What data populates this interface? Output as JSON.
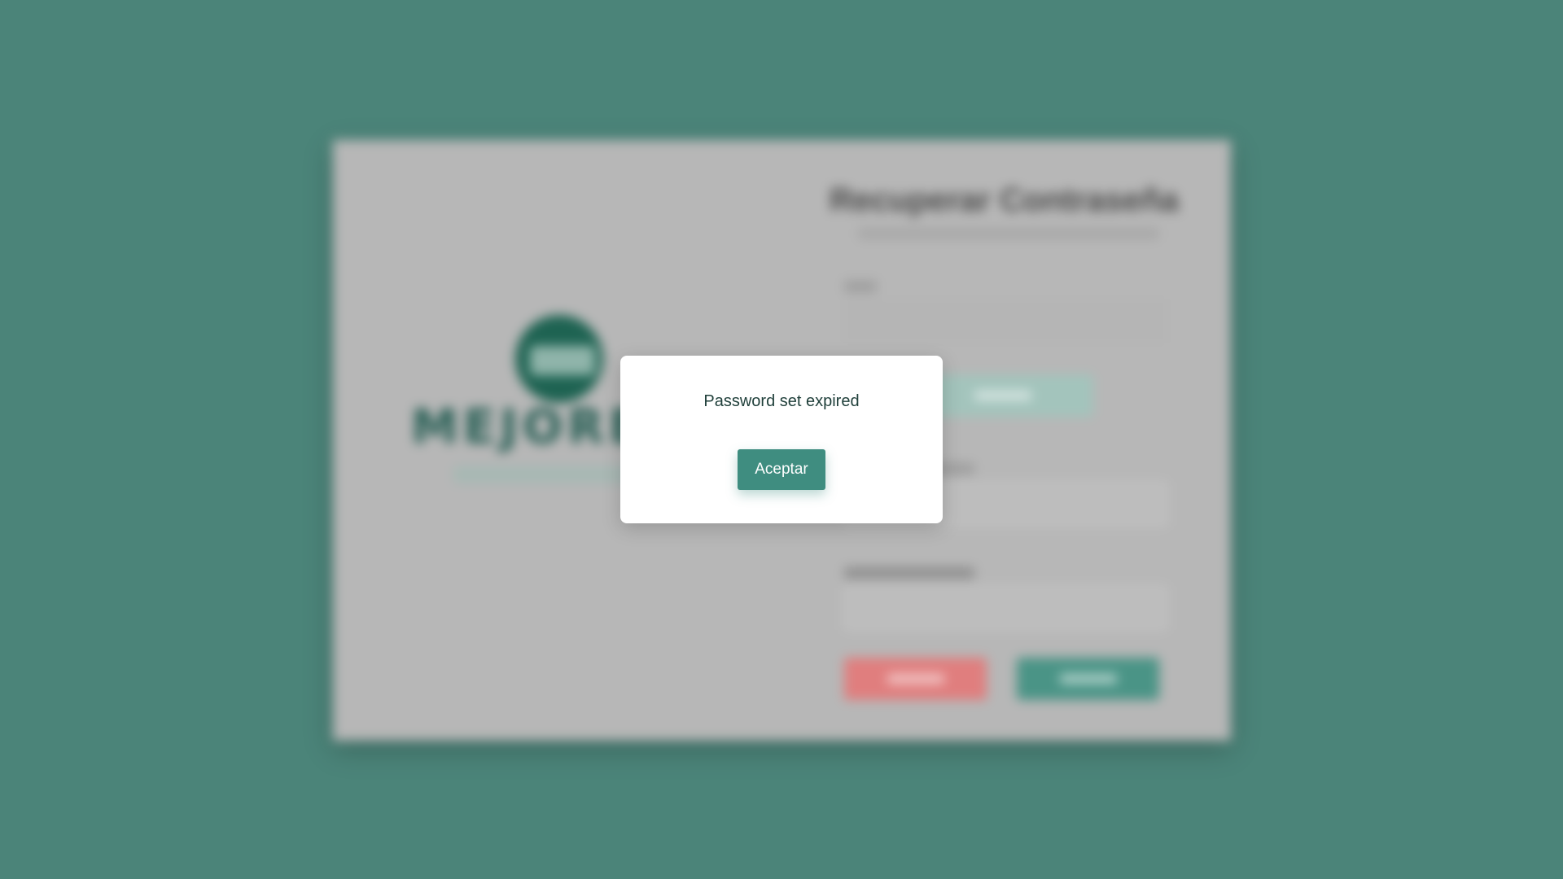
{
  "background_page": {
    "brand": {
      "logo_text": "MEJORE",
      "icon": "globe-logo-icon"
    },
    "form": {
      "title": "Recuperar Contraseña",
      "confirm_password_label": "Repetir Contraseña"
    }
  },
  "modal": {
    "message": "Password set expired",
    "accept_label": "Aceptar"
  },
  "colors": {
    "background": "#4b8479",
    "accent": "#3f8d80",
    "cancel": "#e07e7e"
  }
}
